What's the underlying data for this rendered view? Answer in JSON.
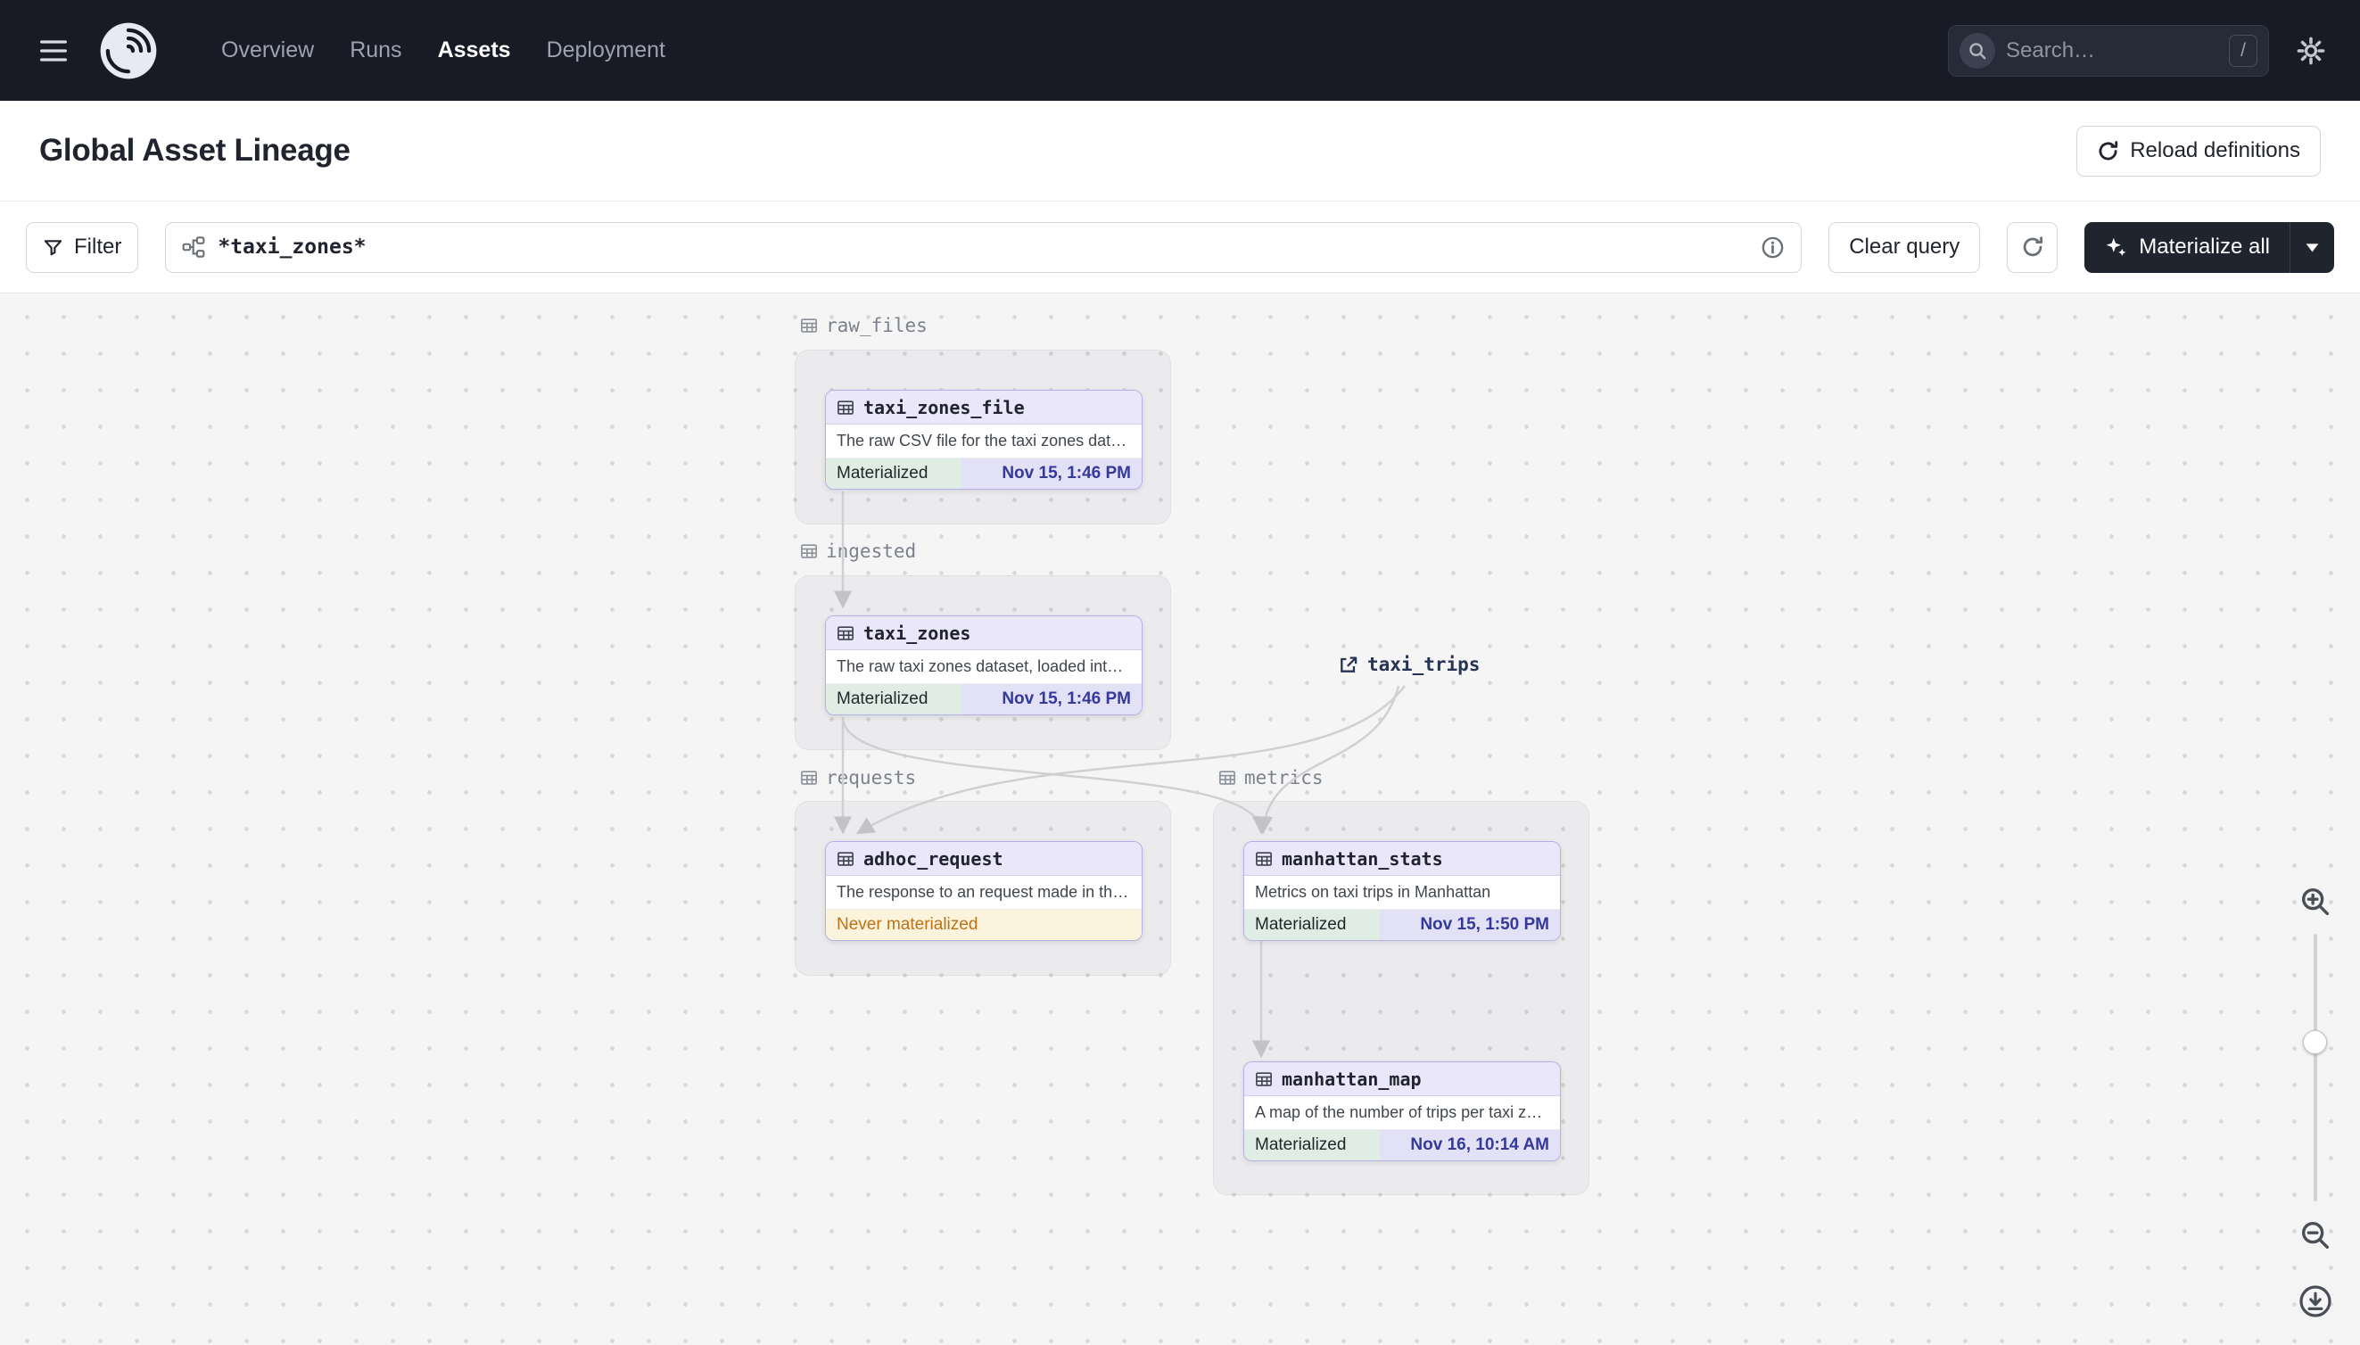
{
  "nav": {
    "brand": "Dagster",
    "items": [
      {
        "label": "Overview",
        "active": false
      },
      {
        "label": "Runs",
        "active": false
      },
      {
        "label": "Assets",
        "active": true
      },
      {
        "label": "Deployment",
        "active": false
      }
    ],
    "search": {
      "placeholder": "Search…",
      "shortcut": "/"
    }
  },
  "header": {
    "title": "Global Asset Lineage",
    "reload_button": "Reload definitions"
  },
  "toolbar": {
    "filter_button": "Filter",
    "query_value": "*taxi_zones*",
    "clear_button": "Clear query",
    "materialize_button": "Materialize all"
  },
  "graph": {
    "groups": [
      {
        "name": "raw_files"
      },
      {
        "name": "ingested"
      },
      {
        "name": "requests"
      },
      {
        "name": "metrics"
      }
    ],
    "nodes": [
      {
        "title": "taxi_zones_file",
        "group": "raw_files",
        "description": "The raw CSV file for the taxi zones dat…",
        "status": "Materialized",
        "timestamp": "Nov 15, 1:46 PM"
      },
      {
        "title": "taxi_zones",
        "group": "ingested",
        "description": "The raw taxi zones dataset, loaded int…",
        "status": "Materialized",
        "timestamp": "Nov 15, 1:46 PM"
      },
      {
        "title": "adhoc_request",
        "group": "requests",
        "description": "The response to an request made in th…",
        "status": "Never materialized",
        "timestamp": ""
      },
      {
        "title": "manhattan_stats",
        "group": "metrics",
        "description": "Metrics on taxi trips in Manhattan",
        "status": "Materialized",
        "timestamp": "Nov 15, 1:50 PM"
      },
      {
        "title": "manhattan_map",
        "group": "metrics",
        "description": "A map of the number of trips per taxi z…",
        "status": "Materialized",
        "timestamp": "Nov 16, 10:14 AM"
      }
    ],
    "external_asset": {
      "label": "taxi_trips"
    },
    "edges": [
      {
        "from": "taxi_zones_file",
        "to": "taxi_zones"
      },
      {
        "from": "taxi_zones",
        "to": "adhoc_request"
      },
      {
        "from": "taxi_zones",
        "to": "manhattan_stats"
      },
      {
        "from": "taxi_trips",
        "to": "adhoc_request"
      },
      {
        "from": "taxi_trips",
        "to": "manhattan_stats"
      },
      {
        "from": "manhattan_stats",
        "to": "manhattan_map"
      }
    ]
  },
  "colors": {
    "topnav_bg": "#181B26",
    "node_header_purple": "#E9E7F9",
    "node_border_purple": "#B5B0E6",
    "materialized_green_bg": "#DFEDE4",
    "timestamp_text_blue": "#34399B",
    "never_materialized_text": "#BE7214",
    "never_materialized_bg": "#FBF3DC",
    "canvas_bg": "#F5F5F6",
    "edge_gray": "#D0D0D2"
  }
}
